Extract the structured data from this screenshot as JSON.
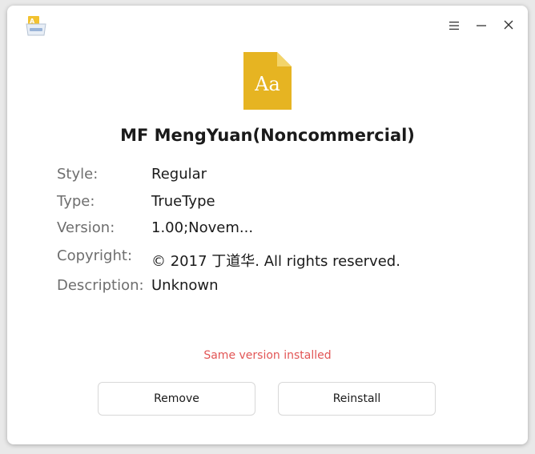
{
  "window": {
    "app_icon": "font-installer-icon",
    "controls": {
      "menu_icon": "hamburger-menu-icon",
      "minimize_icon": "minimize-icon",
      "close_icon": "close-icon"
    }
  },
  "font": {
    "icon": "font-file-icon",
    "icon_text": "Aa",
    "name": "MF MengYuan(Noncommercial)"
  },
  "info": {
    "style_label": "Style:",
    "style_value": "Regular",
    "type_label": "Type:",
    "type_value": "TrueType",
    "version_label": "Version:",
    "version_value": "1.00;Novem...",
    "copyright_label": "Copyright:",
    "copyright_value": "© 2017 丁道华. All rights reserved.",
    "description_label": "Description:",
    "description_value": "Unknown"
  },
  "status": {
    "text": "Same version installed",
    "color": "#e25555"
  },
  "actions": {
    "remove_label": "Remove",
    "reinstall_label": "Reinstall"
  },
  "colors": {
    "accent_file": "#e6b422",
    "file_fold": "#f3d46a"
  }
}
